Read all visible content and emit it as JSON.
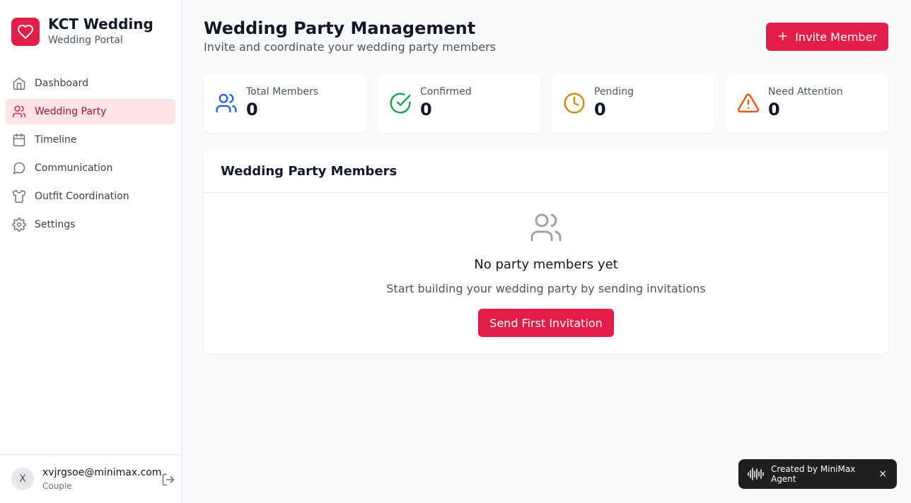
{
  "brand": {
    "title": "KCT Wedding",
    "subtitle": "Wedding Portal",
    "logo_icon": "heart-icon",
    "color": "#e11d48"
  },
  "sidebar": {
    "items": [
      {
        "label": "Dashboard",
        "icon": "home-icon",
        "active": false
      },
      {
        "label": "Wedding Party",
        "icon": "users-icon",
        "active": true
      },
      {
        "label": "Timeline",
        "icon": "calendar-icon",
        "active": false
      },
      {
        "label": "Communication",
        "icon": "chat-icon",
        "active": false
      },
      {
        "label": "Outfit Coordination",
        "icon": "shirt-icon",
        "active": false
      },
      {
        "label": "Settings",
        "icon": "gear-icon",
        "active": false
      }
    ]
  },
  "user": {
    "initial": "X",
    "email": "xvjrgsoe@minimax.com",
    "role": "Couple",
    "logout_icon": "logout-icon"
  },
  "header": {
    "title": "Wedding Party Management",
    "subtitle": "Invite and coordinate your wedding party members",
    "invite_label": "Invite Member",
    "invite_icon": "plus-icon"
  },
  "stats": [
    {
      "label": "Total Members",
      "value": "0",
      "icon": "users-icon",
      "color": "#2563eb"
    },
    {
      "label": "Confirmed",
      "value": "0",
      "icon": "check-circle-icon",
      "color": "#16a34a"
    },
    {
      "label": "Pending",
      "value": "0",
      "icon": "clock-icon",
      "color": "#ca8a04"
    },
    {
      "label": "Need Attention",
      "value": "0",
      "icon": "warning-icon",
      "color": "#ea580c"
    }
  ],
  "members": {
    "title": "Wedding Party Members",
    "empty_icon": "users-icon",
    "empty_title": "No party members yet",
    "empty_subtitle": "Start building your wedding party by sending invitations",
    "cta_label": "Send First Invitation"
  },
  "badge": {
    "text": "Created by MiniMax Agent",
    "close": "×",
    "icon": "waveform-icon"
  }
}
